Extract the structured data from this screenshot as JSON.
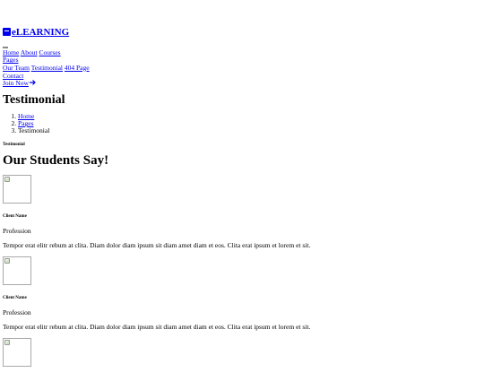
{
  "brand": {
    "icon": "book-icon",
    "name": "eLEARNING"
  },
  "nav": {
    "links": [
      "Home",
      "About",
      "Courses"
    ],
    "pages_label": "Pages",
    "pages_items": [
      "Our Team",
      "Testimonial",
      "404 Page"
    ],
    "contact": "Contact",
    "join": "Join Now",
    "join_icon": "arrow-right-icon"
  },
  "header": {
    "title": "Testimonial",
    "breadcrumb": [
      "Home",
      "Pages",
      "Testimonial"
    ]
  },
  "section": {
    "kicker": "Testimonial",
    "heading": "Our Students Say!"
  },
  "testimonials": [
    {
      "name": "Client Name",
      "profession": "Profession",
      "text": "Tempor erat elitr rebum at clita. Diam dolor diam ipsum sit diam amet diam et eos. Clita erat ipsum et lorem et sit."
    },
    {
      "name": "Client Name",
      "profession": "Profession",
      "text": "Tempor erat elitr rebum at clita. Diam dolor diam ipsum sit diam amet diam et eos. Clita erat ipsum et lorem et sit."
    }
  ],
  "link_color": "#0000ee"
}
